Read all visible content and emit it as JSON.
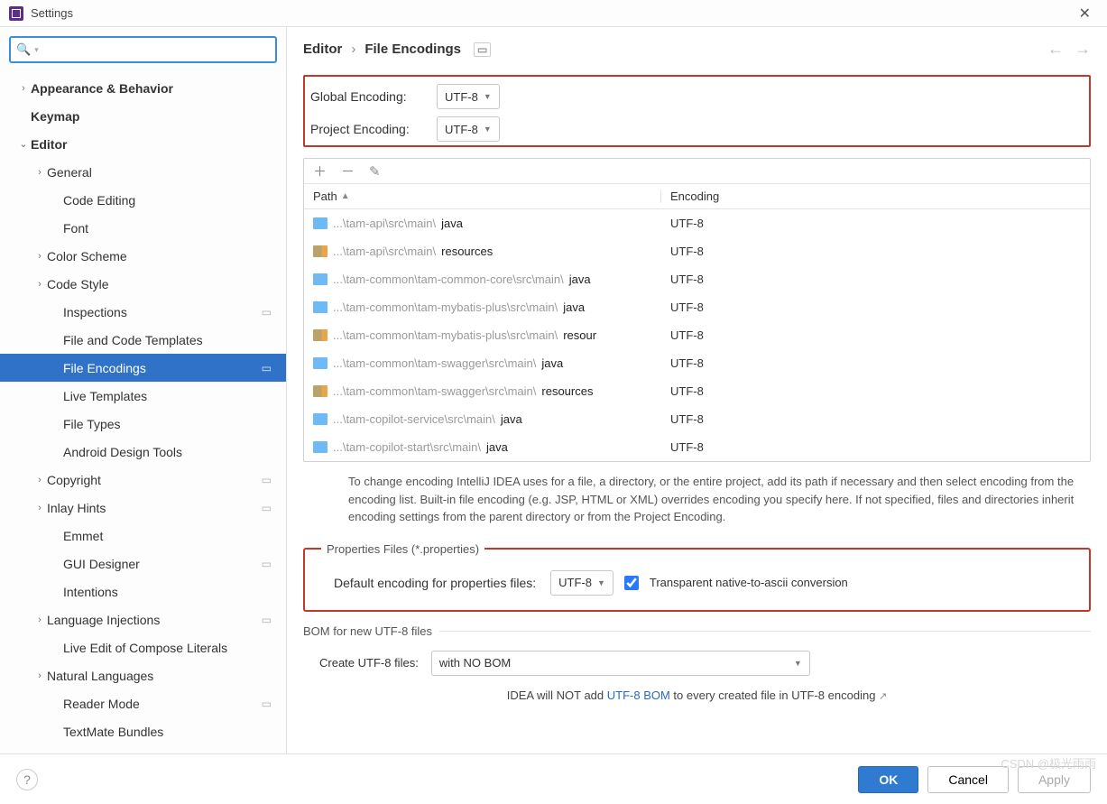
{
  "window": {
    "title": "Settings",
    "search_placeholder": ""
  },
  "sidebar": {
    "items": [
      {
        "label": "Appearance & Behavior",
        "level": 0,
        "bold": true,
        "chev": "›"
      },
      {
        "label": "Keymap",
        "level": 0,
        "bold": true,
        "chev": ""
      },
      {
        "label": "Editor",
        "level": 0,
        "bold": true,
        "chev": "⌄"
      },
      {
        "label": "General",
        "level": 1,
        "chev": "›"
      },
      {
        "label": "Code Editing",
        "level": 2
      },
      {
        "label": "Font",
        "level": 2
      },
      {
        "label": "Color Scheme",
        "level": 1,
        "chev": "›"
      },
      {
        "label": "Code Style",
        "level": 1,
        "chev": "›"
      },
      {
        "label": "Inspections",
        "level": 2,
        "ind": "▭"
      },
      {
        "label": "File and Code Templates",
        "level": 2
      },
      {
        "label": "File Encodings",
        "level": 2,
        "ind": "▭",
        "selected": true
      },
      {
        "label": "Live Templates",
        "level": 2
      },
      {
        "label": "File Types",
        "level": 2
      },
      {
        "label": "Android Design Tools",
        "level": 2
      },
      {
        "label": "Copyright",
        "level": 1,
        "chev": "›",
        "ind": "▭"
      },
      {
        "label": "Inlay Hints",
        "level": 1,
        "chev": "›",
        "ind": "▭"
      },
      {
        "label": "Emmet",
        "level": 2
      },
      {
        "label": "GUI Designer",
        "level": 2,
        "ind": "▭"
      },
      {
        "label": "Intentions",
        "level": 2
      },
      {
        "label": "Language Injections",
        "level": 1,
        "chev": "›",
        "ind": "▭"
      },
      {
        "label": "Live Edit of Compose Literals",
        "level": 2
      },
      {
        "label": "Natural Languages",
        "level": 1,
        "chev": "›"
      },
      {
        "label": "Reader Mode",
        "level": 2,
        "ind": "▭"
      },
      {
        "label": "TextMate Bundles",
        "level": 2
      }
    ]
  },
  "breadcrumbs": {
    "parent": "Editor",
    "current": "File Encodings"
  },
  "encodings": {
    "global_label": "Global Encoding:",
    "global_value": "UTF-8",
    "project_label": "Project Encoding:",
    "project_value": "UTF-8"
  },
  "table": {
    "head_path": "Path",
    "head_enc": "Encoding",
    "rows": [
      {
        "type": "blue",
        "grey": "...\\tam-api\\src\\main\\",
        "black": "java",
        "enc": "UTF-8"
      },
      {
        "type": "res",
        "grey": "...\\tam-api\\src\\main\\",
        "black": "resources",
        "enc": "UTF-8"
      },
      {
        "type": "blue",
        "grey": "...\\tam-common\\tam-common-core\\src\\main\\",
        "black": "java",
        "enc": "UTF-8"
      },
      {
        "type": "blue",
        "grey": "...\\tam-common\\tam-mybatis-plus\\src\\main\\",
        "black": "java",
        "enc": "UTF-8"
      },
      {
        "type": "res",
        "grey": "...\\tam-common\\tam-mybatis-plus\\src\\main\\",
        "black": "resour",
        "enc": "UTF-8"
      },
      {
        "type": "blue",
        "grey": "...\\tam-common\\tam-swagger\\src\\main\\",
        "black": "java",
        "enc": "UTF-8"
      },
      {
        "type": "res",
        "grey": "...\\tam-common\\tam-swagger\\src\\main\\",
        "black": "resources",
        "enc": "UTF-8"
      },
      {
        "type": "blue",
        "grey": "...\\tam-copilot-service\\src\\main\\",
        "black": "java",
        "enc": "UTF-8"
      },
      {
        "type": "blue",
        "grey": "...\\tam-copilot-start\\src\\main\\",
        "black": "java",
        "enc": "UTF-8"
      }
    ]
  },
  "hint": "To change encoding IntelliJ IDEA uses for a file, a directory, or the entire project, add its path if necessary and then select encoding from the encoding list. Built-in file encoding (e.g. JSP, HTML or XML) overrides encoding you specify here. If not specified, files and directories inherit encoding settings from the parent directory or from the Project Encoding.",
  "properties": {
    "legend": "Properties Files (*.properties)",
    "default_label": "Default encoding for properties files:",
    "default_value": "UTF-8",
    "transparent_label": "Transparent native-to-ascii conversion"
  },
  "bom": {
    "legend": "BOM for new UTF-8 files",
    "create_label": "Create UTF-8 files:",
    "create_value": "with NO BOM",
    "note_a": "IDEA will NOT add ",
    "note_link": "UTF-8 BOM",
    "note_b": " to every created file in UTF-8 encoding "
  },
  "footer": {
    "ok": "OK",
    "cancel": "Cancel",
    "apply": "Apply"
  },
  "watermark": "CSDN @极光雨雨"
}
